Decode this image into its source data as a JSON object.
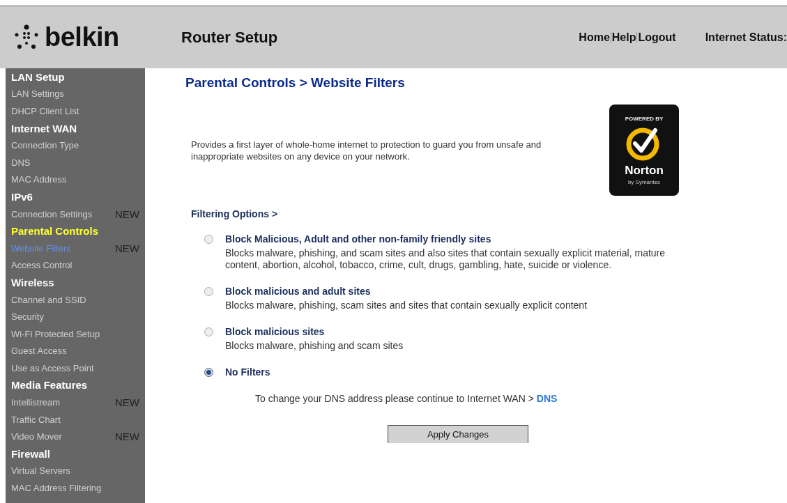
{
  "header": {
    "brand": "belkin",
    "title": "Router Setup",
    "links": [
      "Home",
      "Help",
      "Logout"
    ],
    "status_label": "Internet Status:"
  },
  "sidebar": {
    "items": [
      {
        "kind": "heading",
        "label": "LAN Setup",
        "active": false
      },
      {
        "kind": "link",
        "label": "LAN Settings",
        "selected": false
      },
      {
        "kind": "link",
        "label": "DHCP Client List",
        "selected": false
      },
      {
        "kind": "heading",
        "label": "Internet WAN",
        "active": false
      },
      {
        "kind": "link",
        "label": "Connection Type",
        "selected": false
      },
      {
        "kind": "link",
        "label": "DNS",
        "selected": false
      },
      {
        "kind": "link",
        "label": "MAC Address",
        "selected": false
      },
      {
        "kind": "heading",
        "label": "IPv6",
        "active": false
      },
      {
        "kind": "link",
        "label": "Connection Settings",
        "selected": false,
        "badge": "NEW"
      },
      {
        "kind": "heading",
        "label": "Parental Controls",
        "active": true
      },
      {
        "kind": "link",
        "label": "Website Filters",
        "selected": true,
        "badge": "NEW"
      },
      {
        "kind": "link",
        "label": "Access Control",
        "selected": false
      },
      {
        "kind": "heading",
        "label": "Wireless",
        "active": false
      },
      {
        "kind": "link",
        "label": "Channel and SSID",
        "selected": false
      },
      {
        "kind": "link",
        "label": "Security",
        "selected": false
      },
      {
        "kind": "link",
        "label": "Wi-Fi Protected Setup",
        "selected": false
      },
      {
        "kind": "link",
        "label": "Guest Access",
        "selected": false
      },
      {
        "kind": "link",
        "label": "Use as Access Point",
        "selected": false
      },
      {
        "kind": "heading",
        "label": "Media Features",
        "active": false
      },
      {
        "kind": "link",
        "label": "Intellistream",
        "selected": false,
        "badge": "NEW"
      },
      {
        "kind": "link",
        "label": "Traffic Chart",
        "selected": false
      },
      {
        "kind": "link",
        "label": "Video Mover",
        "selected": false,
        "badge": "NEW"
      },
      {
        "kind": "heading",
        "label": "Firewall",
        "active": false
      },
      {
        "kind": "link",
        "label": "Virtual Servers",
        "selected": false
      },
      {
        "kind": "link",
        "label": "MAC Address Filtering",
        "selected": false
      }
    ]
  },
  "main": {
    "page_title": "Parental Controls > Website Filters",
    "intro": "Provides a first layer of whole-home internet to protection to guard you from unsafe and inappropriate websites on any device on your network.",
    "badge": {
      "top": "POWERED BY",
      "name": "Norton",
      "sub": "by Symantec"
    },
    "section_label": "Filtering Options >",
    "options": [
      {
        "title": "Block Malicious, Adult and other non-family friendly sites",
        "description": "Blocks malware, phishing, and scam sites and also sites that contain sexually explicit material, mature content, abortion, alcohol, tobacco, crime, cult, drugs, gambling, hate, suicide or violence.",
        "selected": false
      },
      {
        "title": "Block malicious and adult sites",
        "description": "Blocks malware, phishing, scam sites and sites that contain sexually explicit content",
        "selected": false
      },
      {
        "title": "Block malicious sites",
        "description": "Blocks malware, phishing and scam sites",
        "selected": false
      },
      {
        "title": "No Filters",
        "selected": true
      }
    ],
    "dns_note": "To change your DNS address please continue to Internet WAN > ",
    "dns_link": "DNS",
    "apply_button": "Apply Changes"
  }
}
